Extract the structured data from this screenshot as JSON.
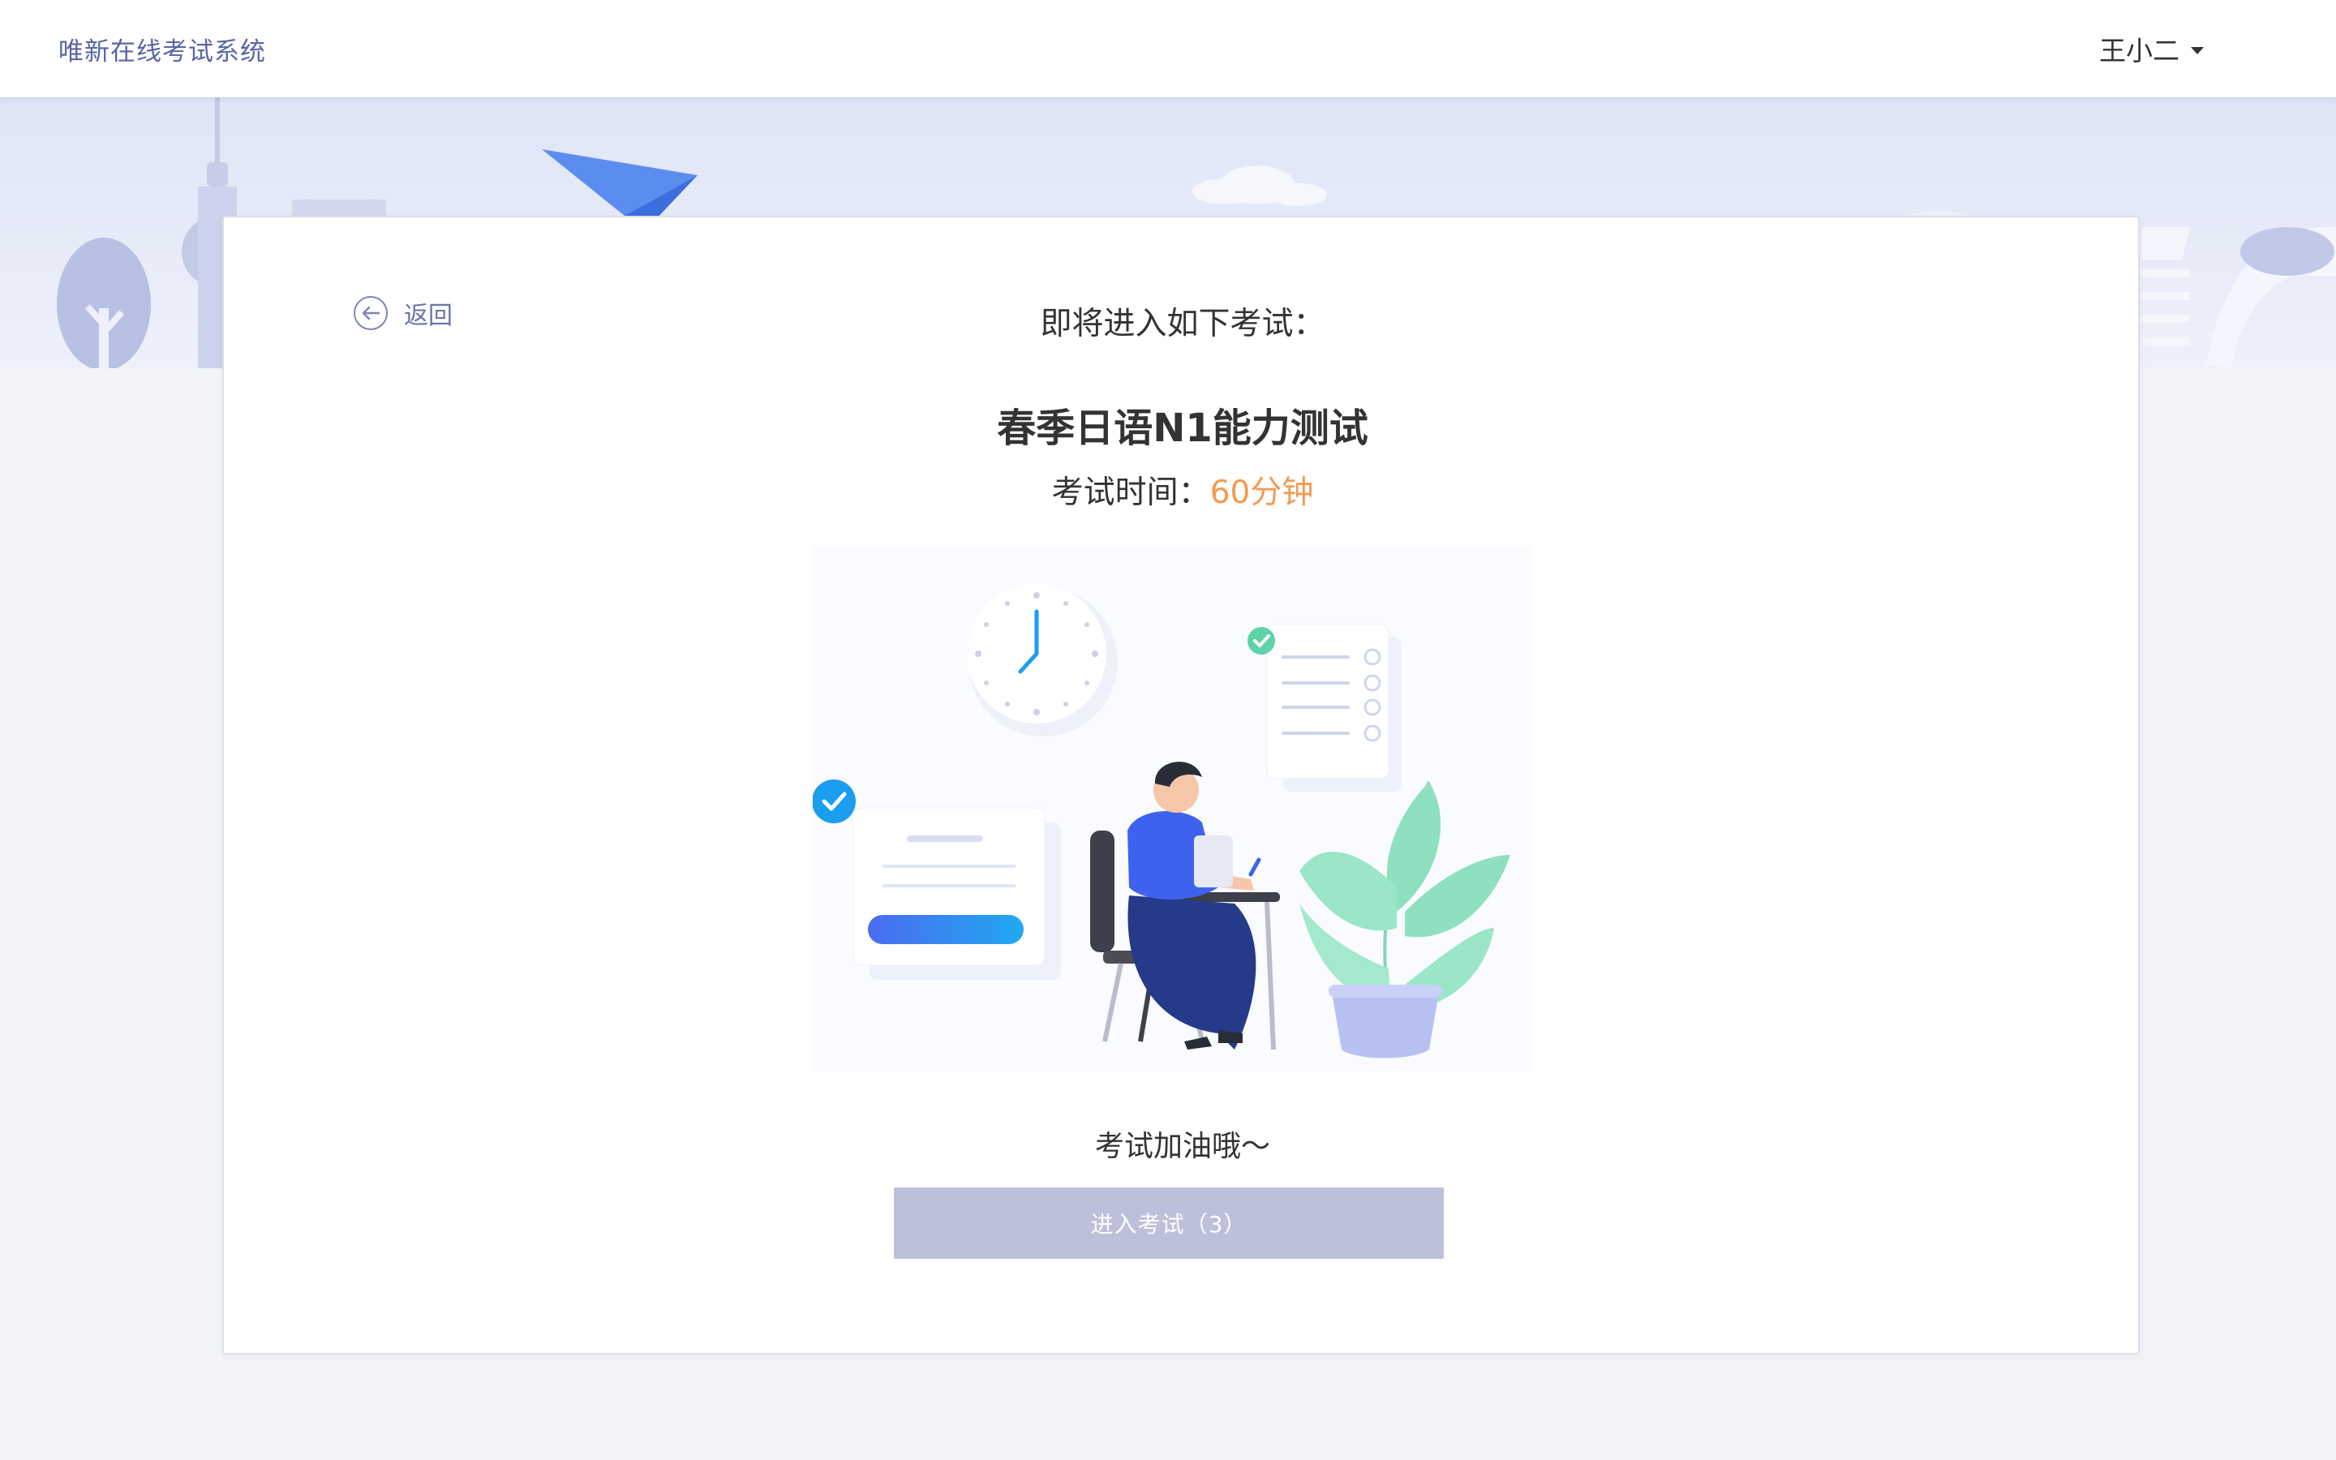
{
  "header": {
    "brand": "唯新在线考试系统",
    "user_name": "王小二"
  },
  "card": {
    "back_label": "返回",
    "intro": "即将进入如下考试：",
    "exam_title": "春季日语N1能力测试",
    "time_label": "考试时间：",
    "time_value": "60分钟",
    "cheer": "考试加油哦～",
    "enter_button": "进入考试（3）"
  },
  "colors": {
    "brand_text": "#5a64a4",
    "accent_time": "#f39a52",
    "button_disabled": "#bcc0d8"
  },
  "icons": [
    "back-arrow-icon",
    "caret-down-icon"
  ]
}
